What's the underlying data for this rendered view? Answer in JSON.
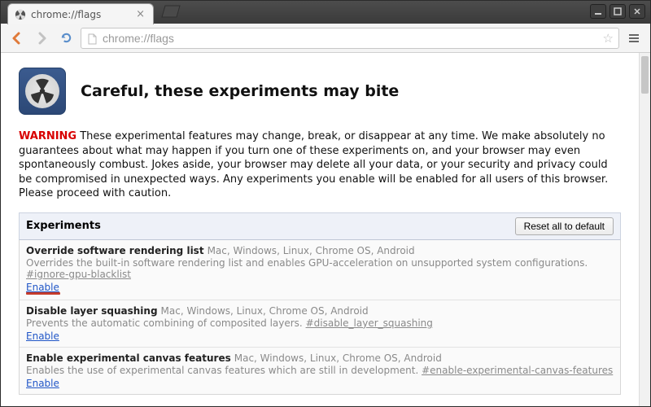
{
  "window": {
    "tab_title": "chrome://flags",
    "url_display": "chrome://flags"
  },
  "page": {
    "title": "Careful, these experiments may bite",
    "warning_label": "WARNING",
    "warning_body": " These experimental features may change, break, or disappear at any time. We make absolutely no guarantees about what may happen if you turn one of these experiments on, and your browser may even spontaneously combust. Jokes aside, your browser may delete all your data, or your security and privacy could be compromised in unexpected ways. Any experiments you enable will be enabled for all users of this browser. Please proceed with caution."
  },
  "experiments_header": {
    "title": "Experiments",
    "reset_label": "Reset all to default"
  },
  "experiments": [
    {
      "title": "Override software rendering list",
      "platforms": "Mac, Windows, Linux, Chrome OS, Android",
      "description": "Overrides the built-in software rendering list and enables GPU-acceleration on unsupported system configurations. ",
      "hash": "#ignore-gpu-blacklist",
      "action_label": "Enable",
      "highlighted": true
    },
    {
      "title": "Disable layer squashing",
      "platforms": "Mac, Windows, Linux, Chrome OS, Android",
      "description": "Prevents the automatic combining of composited layers. ",
      "hash": "#disable_layer_squashing",
      "action_label": "Enable",
      "highlighted": false
    },
    {
      "title": "Enable experimental canvas features",
      "platforms": "Mac, Windows, Linux, Chrome OS, Android",
      "description": "Enables the use of experimental canvas features which are still in development. ",
      "hash": "#enable-experimental-canvas-features",
      "action_label": "Enable",
      "highlighted": false
    }
  ]
}
